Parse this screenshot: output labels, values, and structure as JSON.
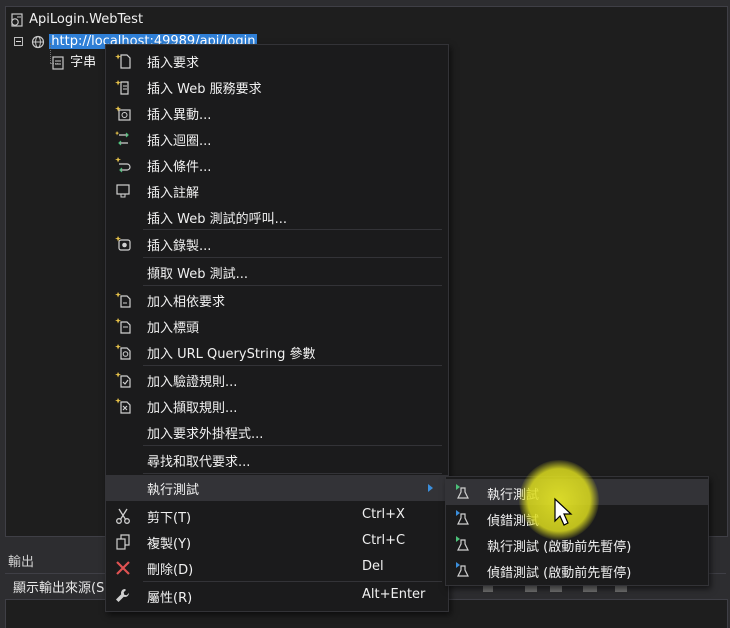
{
  "tree": {
    "project": "ApiLogin.WebTest",
    "request_url": "http://localhost:49989/api/login",
    "child_label": "字串"
  },
  "output": {
    "title": "輸出",
    "source_label": "顯示輸出來源(S"
  },
  "context_menu": {
    "items": [
      {
        "label": "插入要求",
        "icon": "insert-request-icon"
      },
      {
        "label": "插入 Web 服務要求",
        "icon": "insert-web-service-request-icon"
      },
      {
        "label": "插入異動...",
        "icon": "insert-transaction-icon"
      },
      {
        "label": "插入迴圈...",
        "icon": "insert-loop-icon"
      },
      {
        "label": "插入條件...",
        "icon": "insert-condition-icon"
      },
      {
        "label": "插入註解",
        "icon": "insert-comment-icon"
      },
      {
        "label": "插入 Web 測試的呼叫...",
        "icon": ""
      },
      {
        "label": "插入錄製...",
        "icon": "insert-recording-icon"
      },
      {
        "label": "擷取 Web 測試...",
        "icon": ""
      },
      {
        "label": "加入相依要求",
        "icon": "add-dependent-request-icon"
      },
      {
        "label": "加入標頭",
        "icon": "add-header-icon"
      },
      {
        "label": "加入 URL QueryString 參數",
        "icon": "add-querystring-parameter-icon"
      },
      {
        "label": "加入驗證規則...",
        "icon": "add-validation-rule-icon"
      },
      {
        "label": "加入擷取規則...",
        "icon": "add-extraction-rule-icon"
      },
      {
        "label": "加入要求外掛程式...",
        "icon": ""
      },
      {
        "label": "尋找和取代要求...",
        "icon": ""
      },
      {
        "label": "執行測試",
        "icon": "",
        "submenu": true
      },
      {
        "label": "剪下(T)",
        "shortcut": "Ctrl+X",
        "icon": "scissors-icon"
      },
      {
        "label": "複製(Y)",
        "shortcut": "Ctrl+C",
        "icon": "copy-icon"
      },
      {
        "label": "刪除(D)",
        "shortcut": "Del",
        "icon": "delete-icon"
      },
      {
        "label": "屬性(R)",
        "shortcut": "Alt+Enter",
        "icon": "wrench-icon"
      }
    ]
  },
  "submenu": {
    "items": [
      {
        "label": "執行測試",
        "icon": "run-test-icon"
      },
      {
        "label": "偵錯測試",
        "icon": "debug-test-icon"
      },
      {
        "label": "執行測試 (啟動前先暫停)",
        "icon": "run-test-paused-icon"
      },
      {
        "label": "偵錯測試 (啟動前先暫停)",
        "icon": "debug-test-paused-icon"
      }
    ]
  },
  "colors": {
    "menu_bg": "#1b1b1c",
    "highlight": "#333337",
    "selection": "#2f7fd6",
    "cursor_spotlight": "#e6e628"
  }
}
